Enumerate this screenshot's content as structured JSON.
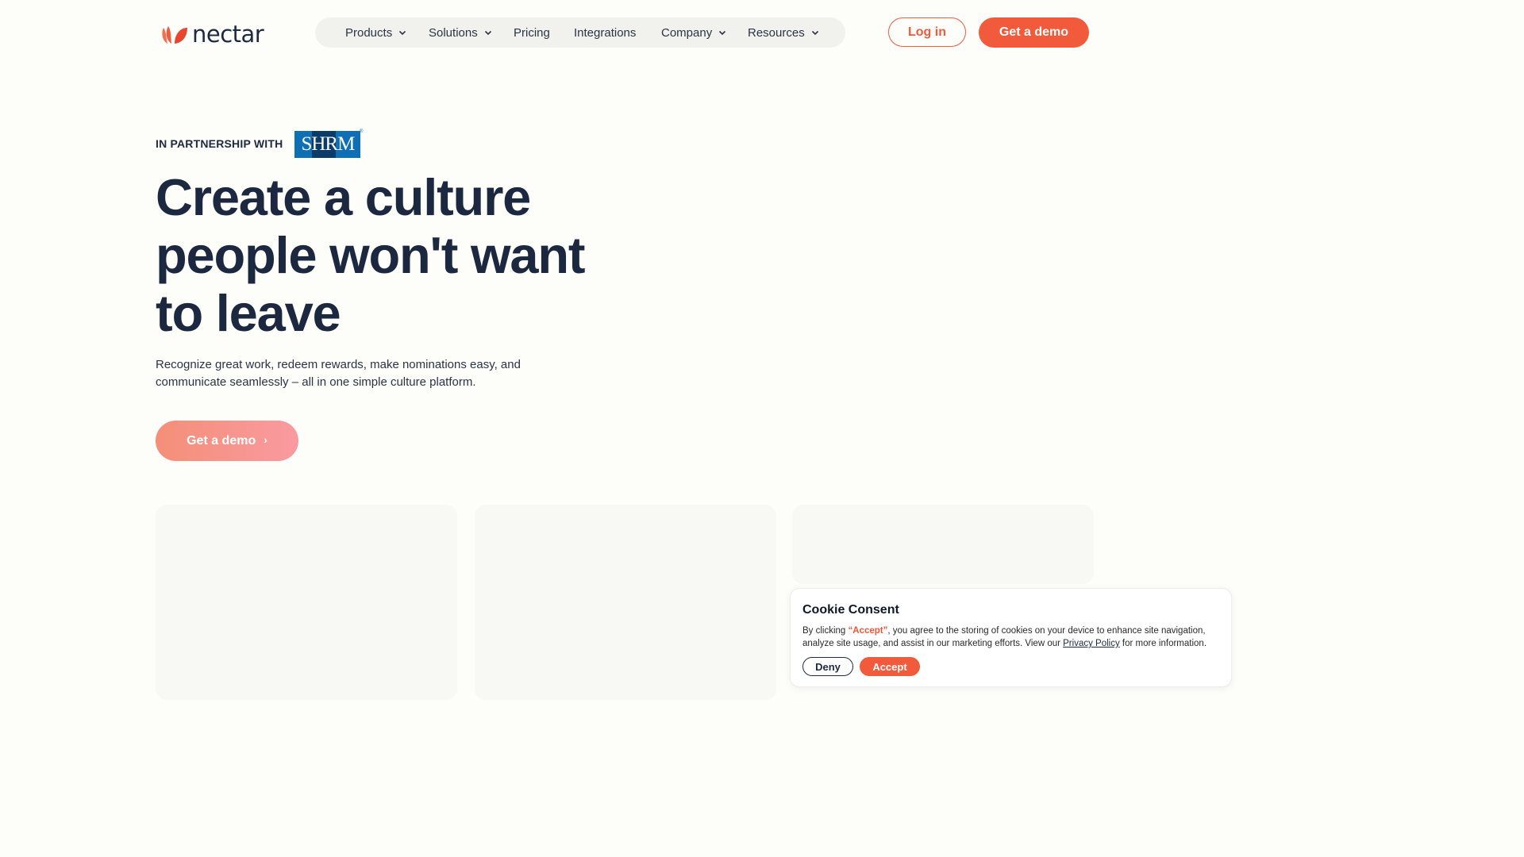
{
  "header": {
    "logo_text": "nectar",
    "nav": [
      {
        "label": "Products",
        "has_dropdown": true
      },
      {
        "label": "Solutions",
        "has_dropdown": true
      },
      {
        "label": "Pricing",
        "has_dropdown": false
      },
      {
        "label": "Integrations",
        "has_dropdown": false
      },
      {
        "label": "Company",
        "has_dropdown": true
      },
      {
        "label": "Resources",
        "has_dropdown": true
      }
    ],
    "login_label": "Log in",
    "demo_label": "Get a demo"
  },
  "hero": {
    "partner_label": "IN PARTNERSHIP WITH",
    "partner_logo_text": "SHRM",
    "partner_logo_mark": "®",
    "headline": "Create a culture people won't want to leave",
    "subtext": "Recognize great work, redeem rewards, make nominations easy, and communicate seamlessly – all in one simple culture platform.",
    "cta_label": "Get a demo",
    "cta_arrow": "›"
  },
  "cookie": {
    "title": "Cookie Consent",
    "text_before": "By clicking ",
    "text_highlight": "“Accept”",
    "text_middle": ", you agree to the storing of cookies on your device to enhance site navigation, analyze site usage, and assist in our marketing efforts. View our ",
    "link_label": "Privacy Policy",
    "text_after": " for more information.",
    "deny_label": "Deny",
    "accept_label": "Accept"
  },
  "colors": {
    "brand": "#f25a3c",
    "navy": "#1c2840",
    "background": "#fdfdf9",
    "shrm_blue": "#0e6fb5"
  }
}
